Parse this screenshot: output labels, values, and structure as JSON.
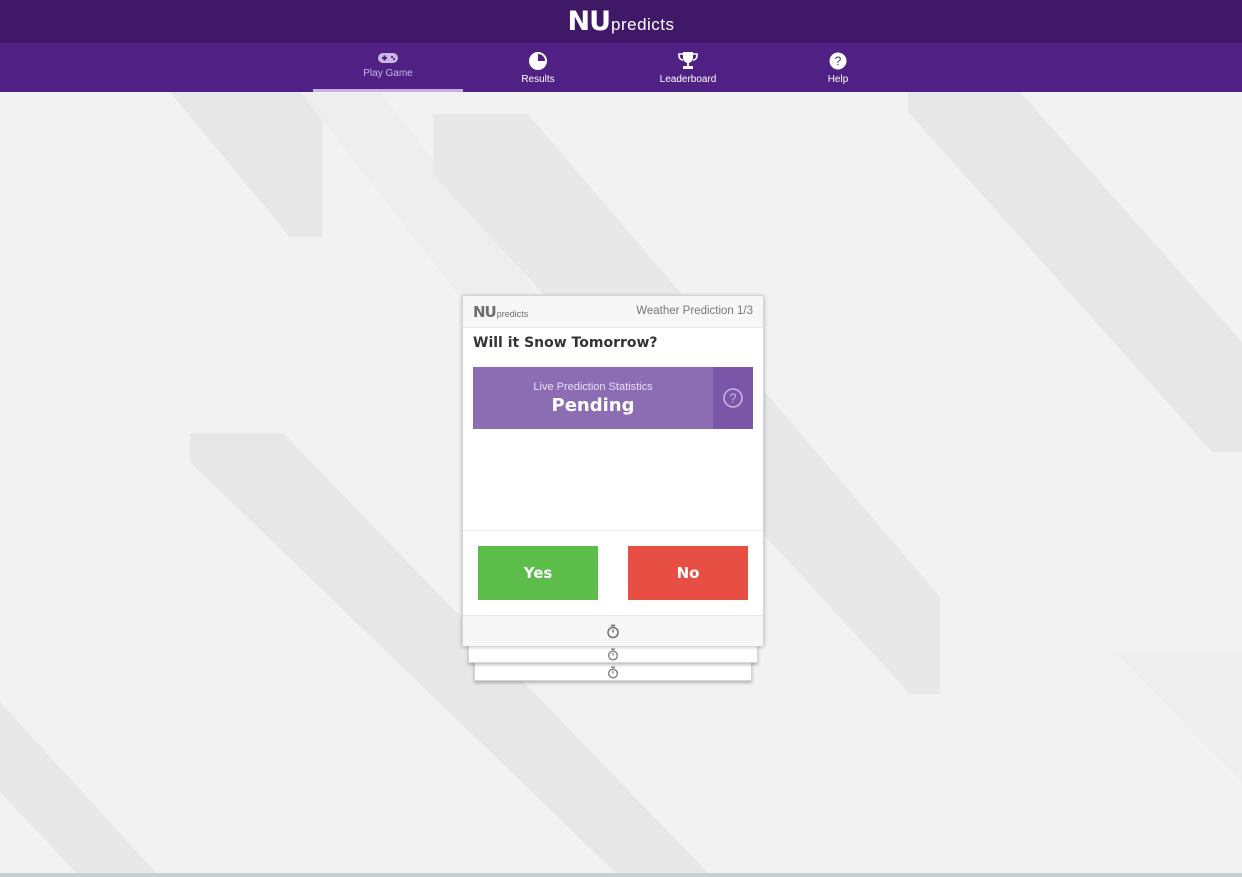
{
  "header": {
    "logo_nu": "NU",
    "logo_predicts": "predicts"
  },
  "nav": {
    "items": [
      {
        "label": "Play Game",
        "icon": "gamepad-icon",
        "active": true
      },
      {
        "label": "Results",
        "icon": "pie-chart-icon",
        "active": false
      },
      {
        "label": "Leaderboard",
        "icon": "trophy-icon",
        "active": false
      },
      {
        "label": "Help",
        "icon": "help-circle-icon",
        "active": false
      }
    ]
  },
  "card": {
    "logo_nu": "NU",
    "logo_predicts": "predicts",
    "category": "Weather Prediction 1/3",
    "question": "Will it Snow Tomorrow?",
    "stats_title": "Live Prediction Statistics",
    "stats_value": "Pending",
    "stats_help_icon": "question-circle-icon",
    "yes_label": "Yes",
    "no_label": "No",
    "footer_icon": "stopwatch-icon"
  },
  "colors": {
    "header_bg": "#401868",
    "nav_bg": "#4f2184",
    "stats_bg": "#8c6db4",
    "yes": "#5dbd4a",
    "no": "#e74e44"
  }
}
